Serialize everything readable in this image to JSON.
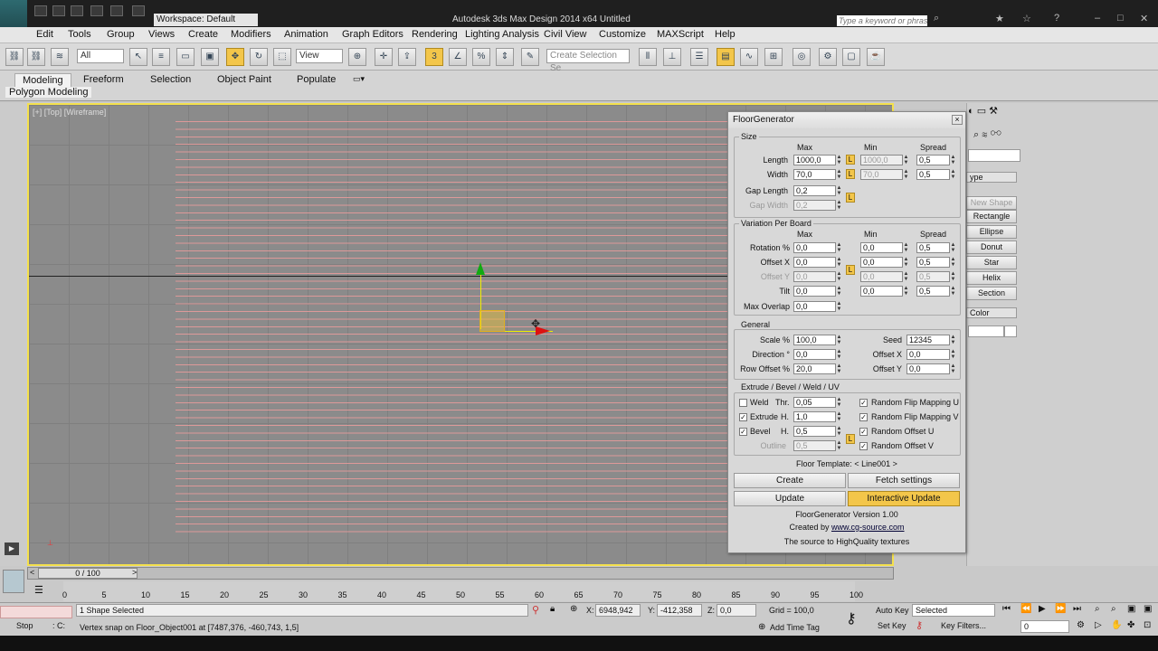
{
  "titlebar": {
    "workspace": "Workspace: Default",
    "app_title": "Autodesk 3ds Max Design 2014 x64      Untitled",
    "search_placeholder": "Type a keyword or phrase",
    "logo": "MXD"
  },
  "menu": [
    "Edit",
    "Tools",
    "Group",
    "Views",
    "Create",
    "Modifiers",
    "Animation",
    "Graph Editors",
    "Rendering",
    "Lighting Analysis",
    "Civil View",
    "Customize",
    "MAXScript",
    "Help"
  ],
  "toolbar": {
    "filter": "All",
    "ref_coord": "View",
    "named_selection_placeholder": "Create Selection Se",
    "snap_label": "3"
  },
  "ribbon": {
    "tabs": [
      "Modeling",
      "Freeform",
      "Selection",
      "Object Paint",
      "Populate"
    ],
    "sub_label": "Polygon Modeling"
  },
  "viewport": {
    "label": "[+] [Top] [Wireframe]"
  },
  "command_panel": {
    "type_label": "ype",
    "buttons": [
      "New Shape",
      "Rectangle",
      "Ellipse",
      "Donut",
      "Star",
      "Helix",
      "Section"
    ],
    "color_label": "Color"
  },
  "floorgen": {
    "title": "FloorGenerator",
    "size": {
      "title": "Size",
      "headers": {
        "max": "Max",
        "min": "Min",
        "spread": "Spread"
      },
      "length": {
        "label": "Length",
        "max": "1000,0",
        "min": "1000,0",
        "spread": "0,5"
      },
      "width": {
        "label": "Width",
        "max": "70,0",
        "min": "70,0",
        "spread": "0,5"
      },
      "gap_length": {
        "label": "Gap Length",
        "max": "0,2"
      },
      "gap_width": {
        "label": "Gap Width",
        "max": "0,2"
      }
    },
    "variation": {
      "title": "Variation Per Board",
      "headers": {
        "max": "Max",
        "min": "Min",
        "spread": "Spread"
      },
      "rotation": {
        "label": "Rotation %",
        "max": "0,0",
        "min": "0,0",
        "spread": "0,5"
      },
      "offset_x": {
        "label": "Offset X",
        "max": "0,0",
        "min": "0,0",
        "spread": "0,5"
      },
      "offset_y": {
        "label": "Offset Y",
        "max": "0,0",
        "min": "0,0",
        "spread": "0,5"
      },
      "tilt": {
        "label": "Tilt",
        "max": "0,0",
        "min": "0,0",
        "spread": "0,5"
      },
      "max_overlap": {
        "label": "Max Overlap",
        "max": "0,0"
      }
    },
    "general": {
      "title": "General",
      "scale": {
        "label": "Scale %",
        "value": "100,0"
      },
      "direction": {
        "label": "Direction °",
        "value": "0,0"
      },
      "row_offset": {
        "label": "Row Offset %",
        "value": "20,0"
      },
      "seed": {
        "label": "Seed",
        "value": "12345"
      },
      "offset_x": {
        "label": "Offset X",
        "value": "0,0"
      },
      "offset_y": {
        "label": "Offset Y",
        "value": "0,0"
      }
    },
    "extrude": {
      "title": "Extrude / Bevel / Weld / UV",
      "weld": {
        "label": "Weld",
        "sub": "Thr.",
        "value": "0,05",
        "checked": false
      },
      "extrude": {
        "label": "Extrude",
        "sub": "H.",
        "value": "1,0",
        "checked": true
      },
      "bevel": {
        "label": "Bevel",
        "sub": "H.",
        "value": "0,5",
        "checked": true
      },
      "outline": {
        "label": "Outline",
        "value": "0,5"
      },
      "flip_u": {
        "label": "Random Flip Mapping U",
        "checked": true
      },
      "flip_v": {
        "label": "Random Flip Mapping V",
        "checked": true
      },
      "offset_u": {
        "label": "Random Offset U",
        "checked": true
      },
      "offset_v": {
        "label": "Random Offset V",
        "checked": true
      }
    },
    "template": "Floor Template: < Line001 >",
    "buttons": {
      "create": "Create",
      "fetch": "Fetch settings",
      "update": "Update",
      "interactive": "Interactive Update"
    },
    "version": "FloorGenerator Version 1.00",
    "created_by": "Created by",
    "site": "www.cg-source.com",
    "tagline": "The source to HighQuality textures",
    "lock": "L",
    "check": "✓"
  },
  "timeline": {
    "frame": "0 / 100",
    "ticks": [
      "0",
      "5",
      "10",
      "15",
      "20",
      "25",
      "30",
      "35",
      "40",
      "45",
      "50",
      "55",
      "60",
      "65",
      "70",
      "75",
      "80",
      "85",
      "90",
      "95",
      "100"
    ]
  },
  "status": {
    "selected": "1 Shape Selected",
    "prompt": "Vertex snap on Floor_Object001 at [7487,376, -460,743, 1,5]",
    "x_label": "X:",
    "x": "6948,942",
    "y_label": "Y:",
    "y": "-412,358",
    "z_label": "Z:",
    "z": "0,0",
    "grid": "Grid = 100,0",
    "add_time_tag": "Add Time Tag",
    "auto_key": "Auto Key",
    "set_key": "Set Key",
    "selected_mode": "Selected",
    "key_filters": "Key Filters...",
    "frame_field": "0",
    "stop": "Stop",
    "c_label": ": C:"
  },
  "colors": {
    "accent": "#f3c64a",
    "viewport_border": "#f4e04d",
    "floor_lines": "#dd9999"
  }
}
